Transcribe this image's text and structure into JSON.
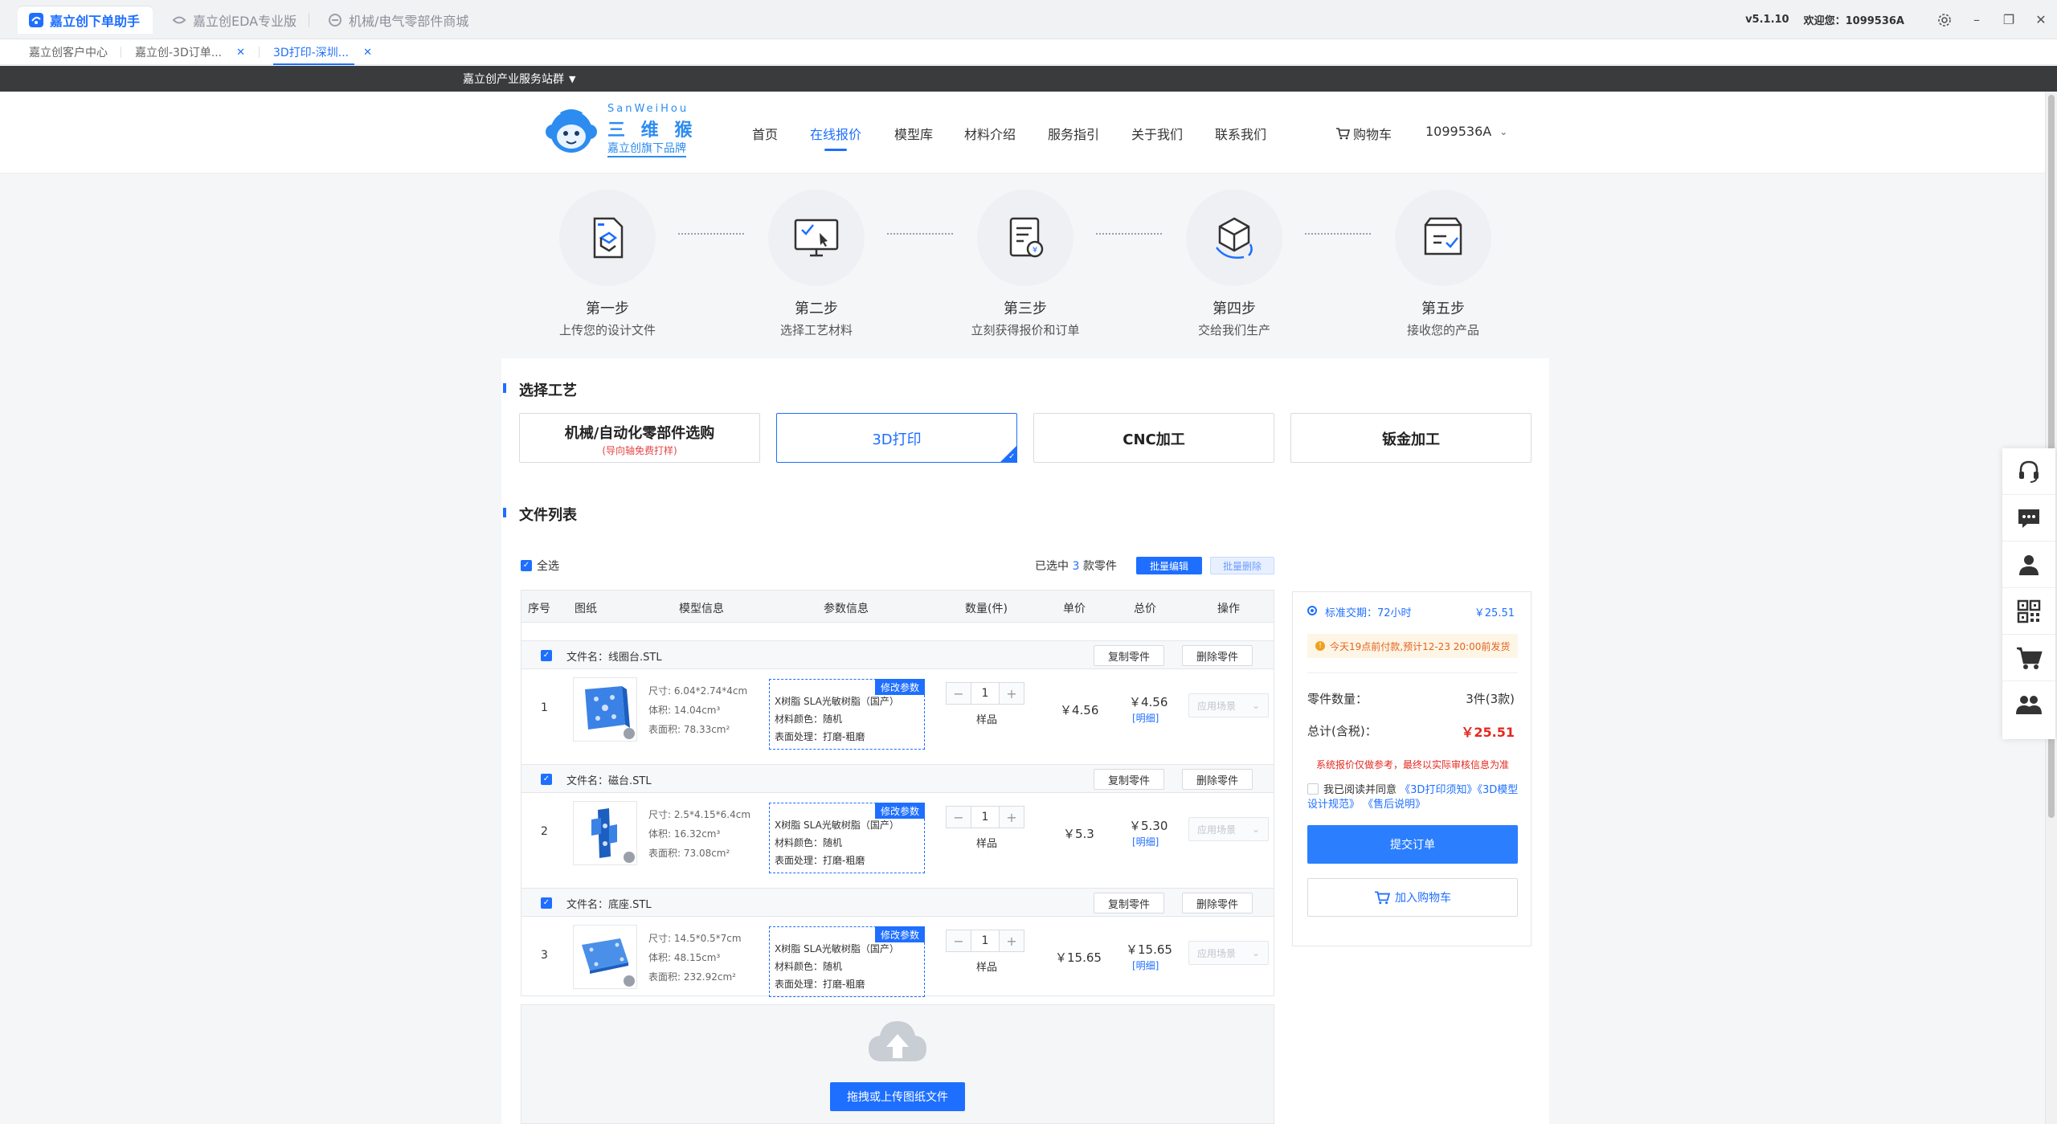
{
  "window": {
    "tabs": [
      {
        "label": "嘉立创下单助手",
        "active": true
      },
      {
        "label": "嘉立创EDA专业版",
        "active": false
      },
      {
        "label": "机械/电气零部件商城",
        "active": false
      }
    ],
    "version": "v5.1.10",
    "welcome": "欢迎您：1099536A"
  },
  "browser_tabs": [
    {
      "label": "嘉立创客户中心",
      "closable": false
    },
    {
      "label": "嘉立创-3D订单...",
      "closable": true
    },
    {
      "label": "3D打印-深圳...",
      "closable": true,
      "active": true
    }
  ],
  "topbar": {
    "label": "嘉立创产业服务站群"
  },
  "header": {
    "logo": {
      "pinyin": "SanWeiHou",
      "name": "三 维 猴",
      "slogan": "嘉立创旗下品牌"
    },
    "nav": [
      "首页",
      "在线报价",
      "模型库",
      "材料介绍",
      "服务指引",
      "关于我们",
      "联系我们"
    ],
    "nav_active": "在线报价",
    "cart": "购物车",
    "user": "1099536A"
  },
  "steps": [
    {
      "title": "第一步",
      "desc": "上传您的设计文件",
      "icon": "file-upload-icon"
    },
    {
      "title": "第二步",
      "desc": "选择工艺材料",
      "icon": "monitor-select-icon"
    },
    {
      "title": "第三步",
      "desc": "立刻获得报价和订单",
      "icon": "quote-document-icon"
    },
    {
      "title": "第四步",
      "desc": "交给我们生产",
      "icon": "cube-production-icon"
    },
    {
      "title": "第五步",
      "desc": "接收您的产品",
      "icon": "delivery-box-icon"
    }
  ],
  "process": {
    "title": "选择工艺",
    "options": [
      {
        "label": "机械/自动化零部件选购",
        "sub": "(导向轴免费打样)"
      },
      {
        "label": "3D打印",
        "sub": "",
        "active": true
      },
      {
        "label": "CNC加工",
        "sub": ""
      },
      {
        "label": "钣金加工",
        "sub": ""
      }
    ]
  },
  "files": {
    "title": "文件列表",
    "select_all": "全选",
    "selected_prefix": "已选中",
    "selected_count": "3",
    "selected_suffix": "款零件",
    "batch_edit": "批量编辑",
    "batch_delete": "批量删除",
    "columns": [
      "序号",
      "图纸",
      "模型信息",
      "参数信息",
      "数量(件)",
      "单价",
      "总价",
      "操作"
    ],
    "copy_label": "复制零件",
    "delete_label": "删除零件",
    "edit_params": "修改参数",
    "sample_label": "样品",
    "detail_label": "[明细]",
    "apply_label": "应用场景",
    "file_label": "文件名：",
    "items": [
      {
        "index": "1",
        "name": "线圈台.STL",
        "size": "尺寸: 6.04*2.74*4cm",
        "volume": "体积: 14.04cm³",
        "area": "表面积: 78.33cm²",
        "material": "X树脂   SLA光敏树脂（国产）",
        "color": "材料颜色：随机",
        "surface": "表面处理：打磨-粗磨",
        "qty": "1",
        "unit_price": "￥4.56",
        "total_price": "￥4.56"
      },
      {
        "index": "2",
        "name": "磁台.STL",
        "size": "尺寸: 2.5*4.15*6.4cm",
        "volume": "体积: 16.32cm³",
        "area": "表面积: 73.08cm²",
        "material": "X树脂   SLA光敏树脂（国产）",
        "color": "材料颜色：随机",
        "surface": "表面处理：打磨-粗磨",
        "qty": "1",
        "unit_price": "￥5.3",
        "total_price": "￥5.30"
      },
      {
        "index": "3",
        "name": "底座.STL",
        "size": "尺寸: 14.5*0.5*7cm",
        "volume": "体积: 48.15cm³",
        "area": "表面积: 232.92cm²",
        "material": "X树脂   SLA光敏树脂（国产）",
        "color": "材料颜色：随机",
        "surface": "表面处理：打磨-粗磨",
        "qty": "1",
        "unit_price": "￥15.65",
        "total_price": "￥15.65"
      }
    ],
    "upload_button": "拖拽或上传图纸文件"
  },
  "summary": {
    "delivery": "标准交期：72小时",
    "delivery_price": "￥25.51",
    "notice": "今天19点前付款,预计12-23 20:00前发货",
    "parts_label": "零件数量：",
    "parts_value": "3件(3款)",
    "total_label": "总计(含税)：",
    "total_value": "￥25.51",
    "reference": "系统报价仅做参考，最终以实际审核信息为准",
    "agree_text": "我已阅读并同意",
    "agree_links": [
      "《3D打印须知》",
      "《3D模型设计规范》",
      "《售后说明》"
    ],
    "submit": "提交订单",
    "add_cart": "加入购物车"
  },
  "side_tools": [
    "headset-icon",
    "chat-icon",
    "user-icon",
    "qrcode-icon",
    "cart-icon",
    "group-icon"
  ],
  "colors": {
    "accent": "#1e6fff",
    "price_red": "#e5281f",
    "dark_strip": "#3a3b3d"
  }
}
